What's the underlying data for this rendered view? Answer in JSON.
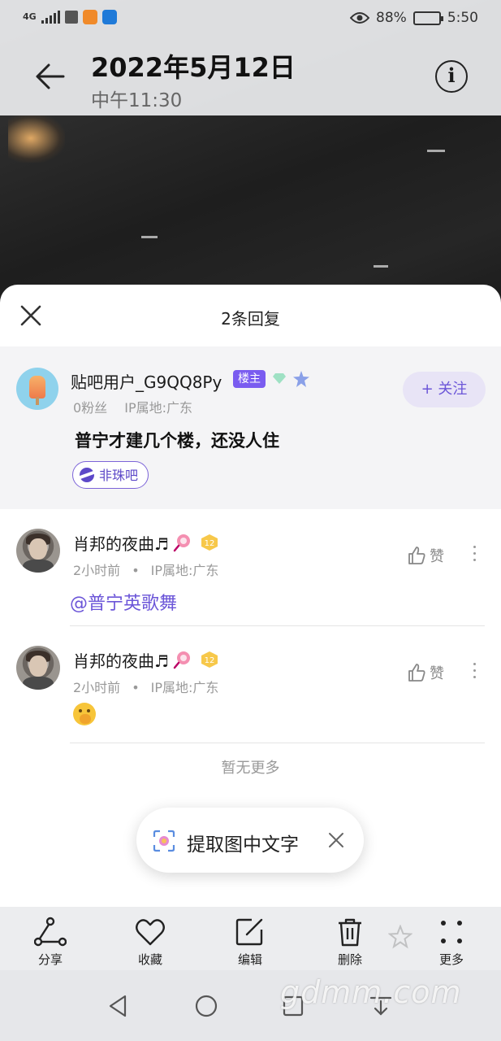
{
  "status_bar": {
    "network": "4G",
    "battery_percent": "88%",
    "time": "5:50"
  },
  "header": {
    "date": "2022年5月12日",
    "time": "中午11:30",
    "back_icon": "arrow-left-icon",
    "info_icon": "info-icon"
  },
  "sheet": {
    "title": "2条回复",
    "close_icon": "close-icon"
  },
  "original_post": {
    "username": "贴吧用户_G9QQ8Py",
    "badge": "楼主",
    "fans": "0粉丝",
    "ip_location": "IP属地:广东",
    "follow_label": "+ 关注",
    "content": "普宁才建几个楼，还没人住",
    "tag": "非珠吧"
  },
  "replies": [
    {
      "username": "肖邦的夜曲♬",
      "level": "12",
      "time": "2小时前",
      "ip_location": "IP属地:广东",
      "like_label": "赞",
      "content": "@普宁英歌舞"
    },
    {
      "username": "肖邦的夜曲♬",
      "level": "12",
      "time": "2小时前",
      "ip_location": "IP属地:广东",
      "like_label": "赞",
      "content": ""
    }
  ],
  "no_more": "暂无更多",
  "ocr_pill": {
    "label": "提取图中文字"
  },
  "toolbar": {
    "share": "分享",
    "favorite": "收藏",
    "edit": "编辑",
    "delete": "删除",
    "more": "更多"
  },
  "watermark": "gdmm.com",
  "colors": {
    "accent": "#6b55d8",
    "badge": "#7a5cf0"
  }
}
